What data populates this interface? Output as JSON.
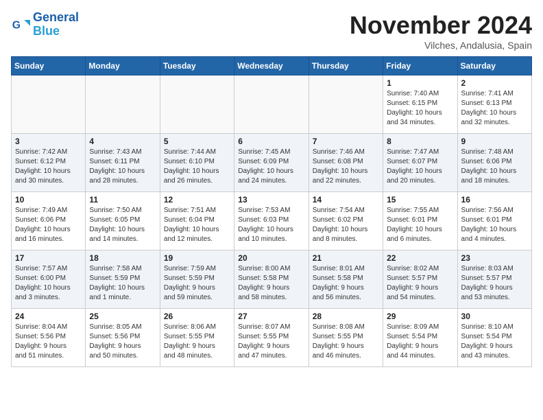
{
  "header": {
    "logo_line1": "General",
    "logo_line2": "Blue",
    "month": "November 2024",
    "location": "Vilches, Andalusia, Spain"
  },
  "weekdays": [
    "Sunday",
    "Monday",
    "Tuesday",
    "Wednesday",
    "Thursday",
    "Friday",
    "Saturday"
  ],
  "weeks": [
    [
      {
        "day": "",
        "info": ""
      },
      {
        "day": "",
        "info": ""
      },
      {
        "day": "",
        "info": ""
      },
      {
        "day": "",
        "info": ""
      },
      {
        "day": "",
        "info": ""
      },
      {
        "day": "1",
        "info": "Sunrise: 7:40 AM\nSunset: 6:15 PM\nDaylight: 10 hours\nand 34 minutes."
      },
      {
        "day": "2",
        "info": "Sunrise: 7:41 AM\nSunset: 6:13 PM\nDaylight: 10 hours\nand 32 minutes."
      }
    ],
    [
      {
        "day": "3",
        "info": "Sunrise: 7:42 AM\nSunset: 6:12 PM\nDaylight: 10 hours\nand 30 minutes."
      },
      {
        "day": "4",
        "info": "Sunrise: 7:43 AM\nSunset: 6:11 PM\nDaylight: 10 hours\nand 28 minutes."
      },
      {
        "day": "5",
        "info": "Sunrise: 7:44 AM\nSunset: 6:10 PM\nDaylight: 10 hours\nand 26 minutes."
      },
      {
        "day": "6",
        "info": "Sunrise: 7:45 AM\nSunset: 6:09 PM\nDaylight: 10 hours\nand 24 minutes."
      },
      {
        "day": "7",
        "info": "Sunrise: 7:46 AM\nSunset: 6:08 PM\nDaylight: 10 hours\nand 22 minutes."
      },
      {
        "day": "8",
        "info": "Sunrise: 7:47 AM\nSunset: 6:07 PM\nDaylight: 10 hours\nand 20 minutes."
      },
      {
        "day": "9",
        "info": "Sunrise: 7:48 AM\nSunset: 6:06 PM\nDaylight: 10 hours\nand 18 minutes."
      }
    ],
    [
      {
        "day": "10",
        "info": "Sunrise: 7:49 AM\nSunset: 6:06 PM\nDaylight: 10 hours\nand 16 minutes."
      },
      {
        "day": "11",
        "info": "Sunrise: 7:50 AM\nSunset: 6:05 PM\nDaylight: 10 hours\nand 14 minutes."
      },
      {
        "day": "12",
        "info": "Sunrise: 7:51 AM\nSunset: 6:04 PM\nDaylight: 10 hours\nand 12 minutes."
      },
      {
        "day": "13",
        "info": "Sunrise: 7:53 AM\nSunset: 6:03 PM\nDaylight: 10 hours\nand 10 minutes."
      },
      {
        "day": "14",
        "info": "Sunrise: 7:54 AM\nSunset: 6:02 PM\nDaylight: 10 hours\nand 8 minutes."
      },
      {
        "day": "15",
        "info": "Sunrise: 7:55 AM\nSunset: 6:01 PM\nDaylight: 10 hours\nand 6 minutes."
      },
      {
        "day": "16",
        "info": "Sunrise: 7:56 AM\nSunset: 6:01 PM\nDaylight: 10 hours\nand 4 minutes."
      }
    ],
    [
      {
        "day": "17",
        "info": "Sunrise: 7:57 AM\nSunset: 6:00 PM\nDaylight: 10 hours\nand 3 minutes."
      },
      {
        "day": "18",
        "info": "Sunrise: 7:58 AM\nSunset: 5:59 PM\nDaylight: 10 hours\nand 1 minute."
      },
      {
        "day": "19",
        "info": "Sunrise: 7:59 AM\nSunset: 5:59 PM\nDaylight: 9 hours\nand 59 minutes."
      },
      {
        "day": "20",
        "info": "Sunrise: 8:00 AM\nSunset: 5:58 PM\nDaylight: 9 hours\nand 58 minutes."
      },
      {
        "day": "21",
        "info": "Sunrise: 8:01 AM\nSunset: 5:58 PM\nDaylight: 9 hours\nand 56 minutes."
      },
      {
        "day": "22",
        "info": "Sunrise: 8:02 AM\nSunset: 5:57 PM\nDaylight: 9 hours\nand 54 minutes."
      },
      {
        "day": "23",
        "info": "Sunrise: 8:03 AM\nSunset: 5:57 PM\nDaylight: 9 hours\nand 53 minutes."
      }
    ],
    [
      {
        "day": "24",
        "info": "Sunrise: 8:04 AM\nSunset: 5:56 PM\nDaylight: 9 hours\nand 51 minutes."
      },
      {
        "day": "25",
        "info": "Sunrise: 8:05 AM\nSunset: 5:56 PM\nDaylight: 9 hours\nand 50 minutes."
      },
      {
        "day": "26",
        "info": "Sunrise: 8:06 AM\nSunset: 5:55 PM\nDaylight: 9 hours\nand 48 minutes."
      },
      {
        "day": "27",
        "info": "Sunrise: 8:07 AM\nSunset: 5:55 PM\nDaylight: 9 hours\nand 47 minutes."
      },
      {
        "day": "28",
        "info": "Sunrise: 8:08 AM\nSunset: 5:55 PM\nDaylight: 9 hours\nand 46 minutes."
      },
      {
        "day": "29",
        "info": "Sunrise: 8:09 AM\nSunset: 5:54 PM\nDaylight: 9 hours\nand 44 minutes."
      },
      {
        "day": "30",
        "info": "Sunrise: 8:10 AM\nSunset: 5:54 PM\nDaylight: 9 hours\nand 43 minutes."
      }
    ]
  ]
}
